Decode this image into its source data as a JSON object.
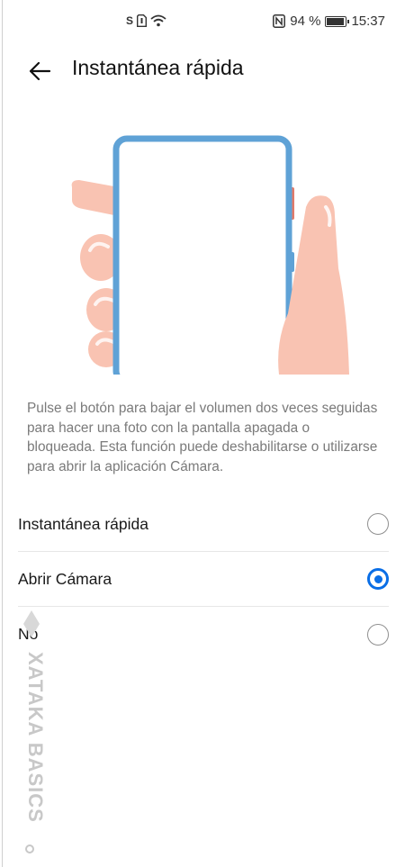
{
  "status_bar": {
    "left_icons": [
      "sim-s-icon",
      "sim-card-icon",
      "wifi-icon"
    ],
    "sim_letter": "S",
    "nfc_label": "N",
    "battery_percent": "94 %",
    "battery_level": 0.94,
    "time": "15:37"
  },
  "app_bar": {
    "back_icon": "arrow-left-icon",
    "title": "Instantánea rápida"
  },
  "description": "Pulse el botón para bajar el volumen dos veces seguidas para hacer una foto con la pantalla apagada o bloqueada. Esta función puede deshabilitarse o utilizarse para abrir la aplicación Cámara.",
  "options": [
    {
      "label": "Instantánea rápida",
      "selected": false
    },
    {
      "label": "Abrir Cámara",
      "selected": true
    },
    {
      "label": "No",
      "selected": false
    }
  ],
  "colors": {
    "accent": "#0a6ee6",
    "phone_frame": "#5fa2d6",
    "skin": "#f9c3b2",
    "side_button": "#e07a6a"
  },
  "watermark": {
    "text": "XATAKA BASICS"
  }
}
